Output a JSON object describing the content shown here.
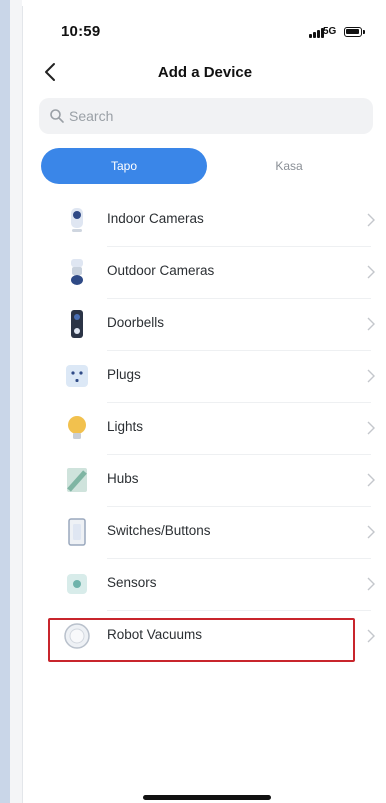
{
  "status_bar": {
    "time": "10:59",
    "network": "5G"
  },
  "nav": {
    "title": "Add a Device"
  },
  "search": {
    "placeholder": "Search"
  },
  "segmented": {
    "tabs": [
      {
        "label": "Tapo",
        "active": true
      },
      {
        "label": "Kasa",
        "active": false
      }
    ]
  },
  "device_types": [
    {
      "label": "Indoor Cameras",
      "icon": "indoor-camera-icon"
    },
    {
      "label": "Outdoor Cameras",
      "icon": "outdoor-camera-icon"
    },
    {
      "label": "Doorbells",
      "icon": "doorbell-icon"
    },
    {
      "label": "Plugs",
      "icon": "plug-icon"
    },
    {
      "label": "Lights",
      "icon": "light-bulb-icon"
    },
    {
      "label": "Hubs",
      "icon": "hub-icon"
    },
    {
      "label": "Switches/Buttons",
      "icon": "switch-icon"
    },
    {
      "label": "Sensors",
      "icon": "sensor-icon"
    },
    {
      "label": "Robot Vacuums",
      "icon": "robot-vacuum-icon",
      "highlighted": true
    }
  ],
  "colors": {
    "accent": "#3a86e8",
    "highlight_border": "#c8252c"
  }
}
